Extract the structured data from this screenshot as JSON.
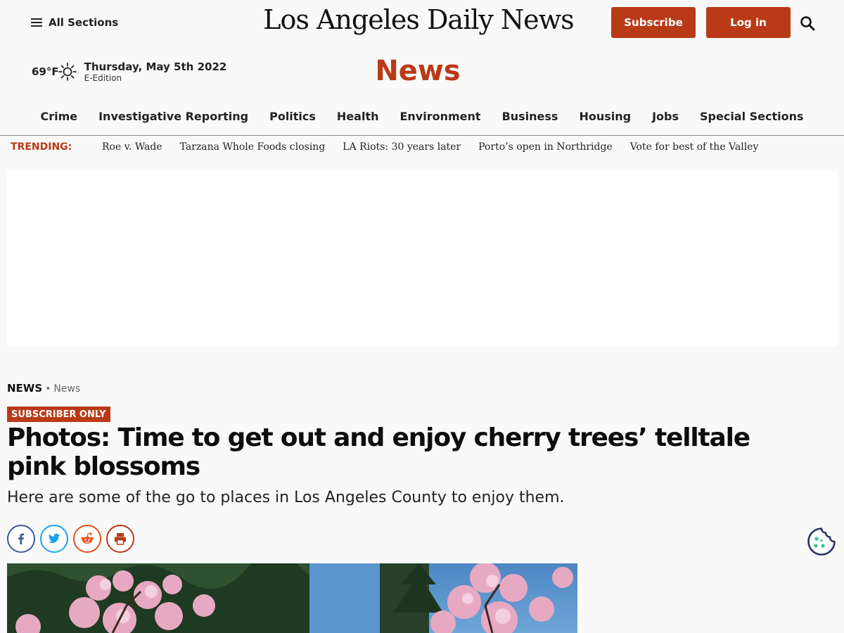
{
  "header": {
    "menu_label": "All Sections",
    "masthead": "Los Angeles Daily News",
    "subscribe_label": "Subscribe",
    "login_label": "Log in"
  },
  "weather": {
    "temperature": "69°F",
    "date": "Thursday, May 5th 2022",
    "edition": "E-Edition"
  },
  "section": {
    "title": "News"
  },
  "nav": {
    "items": [
      "Crime",
      "Investigative Reporting",
      "Politics",
      "Health",
      "Environment",
      "Business",
      "Housing",
      "Jobs",
      "Special Sections"
    ]
  },
  "trending": {
    "label": "TRENDING:",
    "items": [
      "Roe v. Wade",
      "Tarzana Whole Foods closing",
      "LA Riots: 30 years later",
      "Porto’s open in Northridge",
      "Vote for best of the Valley"
    ]
  },
  "article": {
    "breadcrumb_main": "NEWS",
    "breadcrumb_sep": "•",
    "breadcrumb_sub": "News",
    "badge": "SUBSCRIBER ONLY",
    "headline": "Photos: Time to get out and enjoy cherry trees’ telltale pink blossoms",
    "dek": "Here are some of the go to places in Los Angeles County to enjoy them."
  },
  "share_icons": [
    "facebook-icon",
    "twitter-icon",
    "reddit-icon",
    "print-icon"
  ],
  "colors": {
    "accent": "#b93a17",
    "background": "#f9f9f9",
    "facebook": "#3b5a9a",
    "twitter": "#1da1f2",
    "reddit": "#e8501a"
  }
}
